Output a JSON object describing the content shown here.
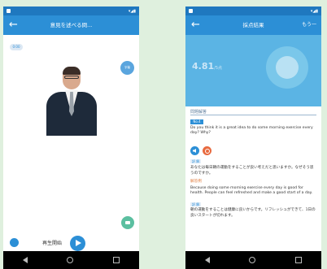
{
  "screen1": {
    "title": "意見を述べる問...",
    "video_badge": "0:00",
    "corner_button": "字幕",
    "play_label": "再生開始"
  },
  "screen2": {
    "title": "採点結果",
    "action": "もう一",
    "score_value": "4.81",
    "score_unit": "/5点",
    "section_label": "問題解答",
    "question_number": "No.4",
    "question_text": "Do you think it is a great idea to do some morning exercise every day? Why?",
    "tag_translation": "訳 解",
    "question_jp": "あなたは毎日朝の運動をすることが良い考えだと思いますか。なぜそう思うのですか。",
    "model_answer_label": "解答例",
    "answer_en": "Because doing some morning exercise every day is good for health. People can feel refreshed and make a good start of a day.",
    "tag_translation2": "訳 解",
    "answer_jp": "朝の運動をすることは健康に良いからです。リフレッシュができて、1日の良いスタートが切れます。"
  },
  "colors": {
    "primary": "#2c8fd6",
    "statusbar": "#1f78bf",
    "background": "#dff0de",
    "score_panel": "#5bb4e4",
    "record": "#e86a3f"
  }
}
